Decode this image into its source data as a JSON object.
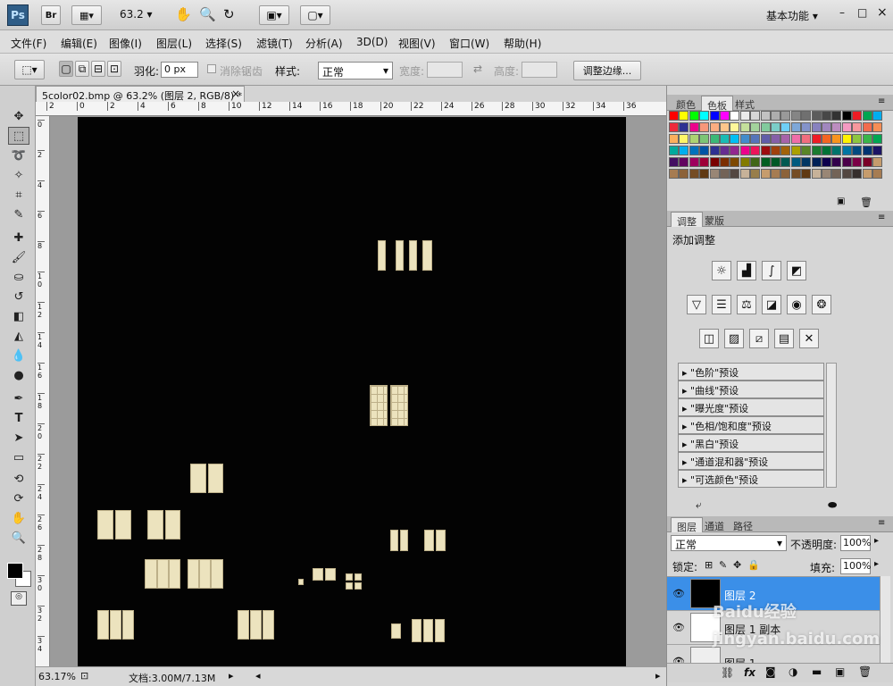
{
  "app": {
    "logo": "Ps",
    "bridge": "Br",
    "zoom_value": "63.2",
    "workspace": "基本功能",
    "window_controls": [
      "–",
      "□",
      "×"
    ]
  },
  "menu": [
    "文件(F)",
    "编辑(E)",
    "图像(I)",
    "图层(L)",
    "选择(S)",
    "滤镜(T)",
    "分析(A)",
    "3D(D)",
    "视图(V)",
    "窗口(W)",
    "帮助(H)"
  ],
  "options": {
    "feather_label": "羽化:",
    "feather_value": "0 px",
    "antialias_label": "消除锯齿",
    "style_label": "样式:",
    "style_value": "正常",
    "width_label": "宽度:",
    "height_label": "高度:",
    "refine_button": "调整边缘..."
  },
  "document": {
    "tab_title": "5color02.bmp @ 63.2% (图层 2, RGB/8) *",
    "ruler_top": [
      "2",
      "0",
      "2",
      "4",
      "6",
      "8",
      "10",
      "12",
      "14",
      "16",
      "18",
      "20",
      "22",
      "24",
      "26",
      "28",
      "30",
      "32",
      "34",
      "36"
    ],
    "ruler_left": [
      "0",
      "2",
      "4",
      "6",
      "8",
      "1 0",
      "1 2",
      "1 4",
      "1 6",
      "1 8",
      "2 0",
      "2 2",
      "2 4",
      "2 6",
      "2 8",
      "3 0",
      "3 2",
      "3 4"
    ]
  },
  "status": {
    "zoom": "63.17%",
    "doc_info": "文档:3.00M/7.13M"
  },
  "swatches": {
    "tabs": [
      "颜色",
      "色板",
      "样式"
    ],
    "active_tab": "色板",
    "colors": [
      "#ff0000",
      "#ffff00",
      "#00ff00",
      "#00ffff",
      "#0000ff",
      "#ff00ff",
      "#ffffff",
      "#ebebeb",
      "#d6d6d6",
      "#c2c2c2",
      "#adadad",
      "#999999",
      "#858585",
      "#707070",
      "#5c5c5c",
      "#474747",
      "#333333",
      "#000000",
      "#ed1c24",
      "#00a651",
      "#00aeef",
      "#ee2b3b",
      "#2e3192",
      "#ec008c",
      "#f7977a",
      "#fbad82",
      "#fdc68c",
      "#fff79a",
      "#c4df9b",
      "#a3d39c",
      "#82ca9d",
      "#7bcdc8",
      "#6ecff6",
      "#7ea7d8",
      "#8493ca",
      "#8882be",
      "#a187be",
      "#bc8dbf",
      "#f49ac2",
      "#f6989d",
      "#f26c4f",
      "#f68e56",
      "#fbaf5d",
      "#fff568",
      "#acd372",
      "#7cc576",
      "#3bb878",
      "#1abbb4",
      "#00bff3",
      "#438ccb",
      "#5574b9",
      "#605ca8",
      "#855fa8",
      "#a763a9",
      "#ef6ea8",
      "#f16d7e",
      "#ed1c24",
      "#f26522",
      "#f7941d",
      "#fff200",
      "#8dc63f",
      "#39b54a",
      "#00a651",
      "#00a99d",
      "#00aeef",
      "#0072bc",
      "#0054a6",
      "#2e3192",
      "#662d91",
      "#92278f",
      "#ec008c",
      "#ed145b",
      "#9e0b0f",
      "#a0410d",
      "#a36209",
      "#aba000",
      "#598527",
      "#197b30",
      "#007236",
      "#00746b",
      "#0076a3",
      "#004b80",
      "#003471",
      "#1b1464",
      "#440e62",
      "#630460",
      "#9e005d",
      "#9e0039",
      "#790000",
      "#7b2e00",
      "#7d4900",
      "#827b00",
      "#406618",
      "#005e20",
      "#005826",
      "#005952",
      "#005b7f",
      "#003663",
      "#002157",
      "#0d004c",
      "#32004b",
      "#4b0049",
      "#7b0046",
      "#7a0026",
      "#c69c6d",
      "#a67c52",
      "#8c6239",
      "#754c24",
      "#603913",
      "#998675",
      "#736357",
      "#534741",
      "#c7b299",
      "#987e4b",
      "#c69c6d",
      "#a67c52",
      "#8c6239",
      "#754c24",
      "#603913",
      "#c7b299",
      "#998675",
      "#736357",
      "#534741",
      "#362f2d",
      "#c69c6d",
      "#a67c52"
    ]
  },
  "adjustments": {
    "tabs": [
      "调整",
      "蒙版"
    ],
    "active_tab": "调整",
    "title": "添加调整",
    "row1_icons": [
      "brightness-icon",
      "levels-icon",
      "curves-icon",
      "exposure-icon"
    ],
    "row2_icons": [
      "vibrance-icon",
      "hue-saturation-icon",
      "color-balance-icon",
      "black-white-icon",
      "photo-filter-icon",
      "channel-mixer-icon"
    ],
    "row3_icons": [
      "invert-icon",
      "posterize-icon",
      "threshold-icon",
      "gradient-map-icon",
      "selective-color-icon"
    ],
    "presets": [
      "\"色阶\"预设",
      "\"曲线\"预设",
      "\"曝光度\"预设",
      "\"色相/饱和度\"预设",
      "\"黑白\"预设",
      "\"通道混和器\"预设",
      "\"可选颜色\"预设"
    ]
  },
  "layers": {
    "tabs": [
      "图层",
      "通道",
      "路径"
    ],
    "active_tab": "图层",
    "blend_mode": "正常",
    "opacity_label": "不透明度:",
    "opacity_value": "100%",
    "lock_label": "锁定:",
    "fill_label": "填充:",
    "fill_value": "100%",
    "items": [
      {
        "name": "图层 2",
        "selected": true
      },
      {
        "name": "图层 1 副本",
        "selected": false
      },
      {
        "name": "图层 1",
        "selected": false
      }
    ],
    "bottom_icons": [
      "link-icon",
      "fx-icon",
      "mask-icon",
      "adjustment-layer-icon",
      "group-icon",
      "new-layer-icon",
      "trash-icon"
    ]
  },
  "watermark": "Baidu经验 jingyan.baidu.com"
}
